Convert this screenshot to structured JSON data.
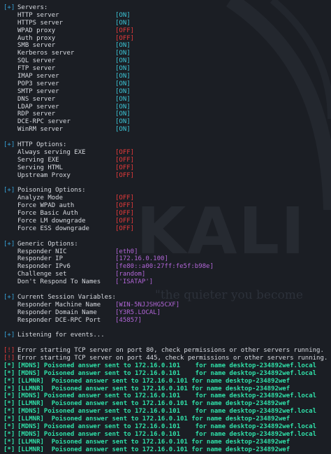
{
  "background": {
    "watermark": "KALI",
    "tagline": "\"the quieter you become"
  },
  "colors": {
    "background": "#1b1e24",
    "header_tag": "#36a3d9",
    "on": "#3cc5d6",
    "off": "#ea3b3b",
    "purple_value": "#b266d8",
    "event_green": "#2fe0a8",
    "error_tag": "#ea3b3b"
  },
  "sections": [
    {
      "tag": "[+]",
      "title": "Servers:",
      "items": [
        {
          "label": "HTTP server",
          "value": "[ON]",
          "kind": "on"
        },
        {
          "label": "HTTPS server",
          "value": "[ON]",
          "kind": "on"
        },
        {
          "label": "WPAD proxy",
          "value": "[OFF]",
          "kind": "off"
        },
        {
          "label": "Auth proxy",
          "value": "[OFF]",
          "kind": "off"
        },
        {
          "label": "SMB server",
          "value": "[ON]",
          "kind": "on"
        },
        {
          "label": "Kerberos server",
          "value": "[ON]",
          "kind": "on"
        },
        {
          "label": "SQL server",
          "value": "[ON]",
          "kind": "on"
        },
        {
          "label": "FTP server",
          "value": "[ON]",
          "kind": "on"
        },
        {
          "label": "IMAP server",
          "value": "[ON]",
          "kind": "on"
        },
        {
          "label": "POP3 server",
          "value": "[ON]",
          "kind": "on"
        },
        {
          "label": "SMTP server",
          "value": "[ON]",
          "kind": "on"
        },
        {
          "label": "DNS server",
          "value": "[ON]",
          "kind": "on"
        },
        {
          "label": "LDAP server",
          "value": "[ON]",
          "kind": "on"
        },
        {
          "label": "RDP server",
          "value": "[ON]",
          "kind": "on"
        },
        {
          "label": "DCE-RPC server",
          "value": "[ON]",
          "kind": "on"
        },
        {
          "label": "WinRM server",
          "value": "[ON]",
          "kind": "on"
        }
      ]
    },
    {
      "tag": "[+]",
      "title": "HTTP Options:",
      "items": [
        {
          "label": "Always serving EXE",
          "value": "[OFF]",
          "kind": "off"
        },
        {
          "label": "Serving EXE",
          "value": "[OFF]",
          "kind": "off"
        },
        {
          "label": "Serving HTML",
          "value": "[OFF]",
          "kind": "off"
        },
        {
          "label": "Upstream Proxy",
          "value": "[OFF]",
          "kind": "off"
        }
      ]
    },
    {
      "tag": "[+]",
      "title": "Poisoning Options:",
      "items": [
        {
          "label": "Analyze Mode",
          "value": "[OFF]",
          "kind": "off"
        },
        {
          "label": "Force WPAD auth",
          "value": "[OFF]",
          "kind": "off"
        },
        {
          "label": "Force Basic Auth",
          "value": "[OFF]",
          "kind": "off"
        },
        {
          "label": "Force LM downgrade",
          "value": "[OFF]",
          "kind": "off"
        },
        {
          "label": "Force ESS downgrade",
          "value": "[OFF]",
          "kind": "off"
        }
      ]
    },
    {
      "tag": "[+]",
      "title": "Generic Options:",
      "items": [
        {
          "label": "Responder NIC",
          "value": "[eth0]",
          "kind": "purple"
        },
        {
          "label": "Responder IP",
          "value": "[172.16.0.100]",
          "kind": "purple"
        },
        {
          "label": "Responder IPv6",
          "value": "[fe80::a00:27ff:fe5f:b98e]",
          "kind": "purple"
        },
        {
          "label": "Challenge set",
          "value": "[random]",
          "kind": "purple"
        },
        {
          "label": "Don't Respond To Names",
          "value": "['ISATAP']",
          "kind": "purple"
        }
      ]
    },
    {
      "tag": "[+]",
      "title": "Current Session Variables:",
      "items": [
        {
          "label": "Responder Machine Name",
          "value": "[WIN-5NJJSHG5CXF]",
          "kind": "purple"
        },
        {
          "label": "Responder Domain Name",
          "value": "[Y3R5.LOCAL]",
          "kind": "purple"
        },
        {
          "label": "Responder DCE-RPC Port",
          "value": "[45857]",
          "kind": "purple"
        }
      ]
    }
  ],
  "listening": {
    "tag": "[+]",
    "text": "Listening for events..."
  },
  "events": [
    {
      "tag": "[!]",
      "kind": "err",
      "text": "Error starting TCP server on port 80, check permissions or other servers running."
    },
    {
      "tag": "[!]",
      "kind": "err",
      "text": "Error starting TCP server on port 445, check permissions or other servers running."
    },
    {
      "tag": "[*]",
      "kind": "ok",
      "text": "[MDNS] Poisoned answer sent to 172.16.0.101    for name desktop-234892wef.local"
    },
    {
      "tag": "[*]",
      "kind": "ok",
      "text": "[MDNS] Poisoned answer sent to 172.16.0.101    for name desktop-234892wef.local"
    },
    {
      "tag": "[*]",
      "kind": "ok",
      "text": "[LLMNR]  Poisoned answer sent to 172.16.0.101 for name desktop-234892wef"
    },
    {
      "tag": "[*]",
      "kind": "ok",
      "text": "[LLMNR]  Poisoned answer sent to 172.16.0.101 for name desktop-234892wef"
    },
    {
      "tag": "[*]",
      "kind": "ok",
      "text": "[MDNS] Poisoned answer sent to 172.16.0.101    for name desktop-234892wef.local"
    },
    {
      "tag": "[*]",
      "kind": "ok",
      "text": "[LLMNR]  Poisoned answer sent to 172.16.0.101 for name desktop-234892wef"
    },
    {
      "tag": "[*]",
      "kind": "ok",
      "text": "[MDNS] Poisoned answer sent to 172.16.0.101    for name desktop-234892wef.local"
    },
    {
      "tag": "[*]",
      "kind": "ok",
      "text": "[LLMNR]  Poisoned answer sent to 172.16.0.101 for name desktop-234892wef"
    },
    {
      "tag": "[*]",
      "kind": "ok",
      "text": "[MDNS] Poisoned answer sent to 172.16.0.101    for name desktop-234892wef.local"
    },
    {
      "tag": "[*]",
      "kind": "ok",
      "text": "[MDNS] Poisoned answer sent to 172.16.0.101    for name desktop-234892wef.local"
    },
    {
      "tag": "[*]",
      "kind": "ok",
      "text": "[LLMNR]  Poisoned answer sent to 172.16.0.101 for name desktop-234892wef"
    },
    {
      "tag": "[*]",
      "kind": "ok",
      "text": "[LLMNR]  Poisoned answer sent to 172.16.0.101 for name desktop-234892wef"
    }
  ]
}
